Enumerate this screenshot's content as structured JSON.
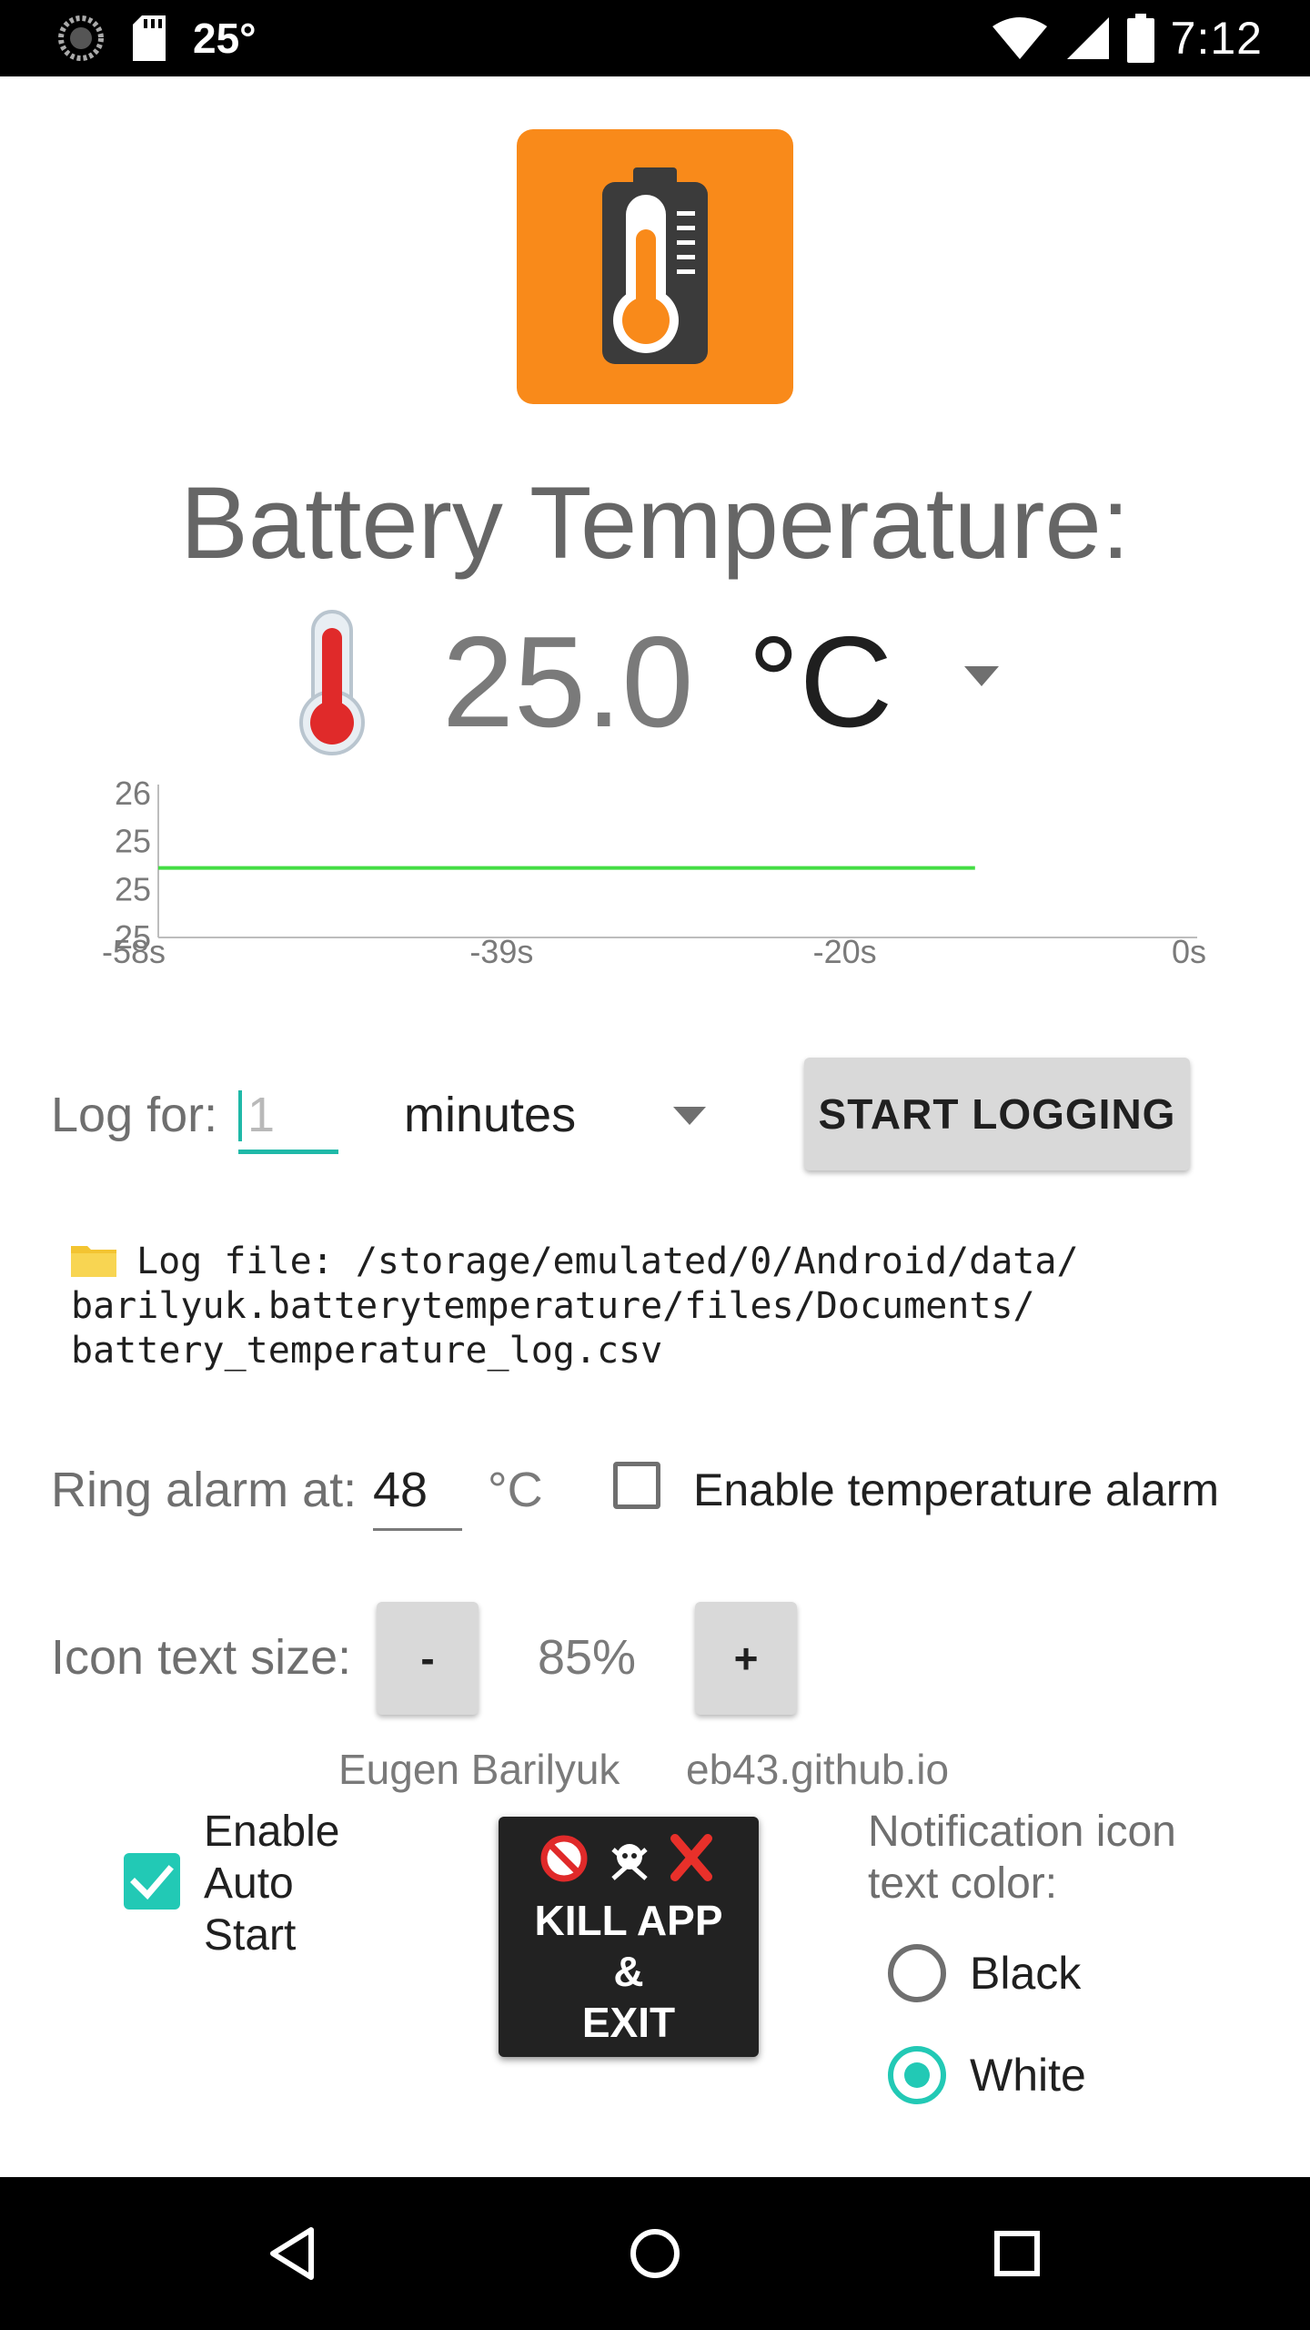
{
  "status_bar": {
    "temperature": "25°",
    "time": "7:12",
    "icons": [
      "clock-icon",
      "sd-card-icon",
      "wifi-icon",
      "cell-signal-icon",
      "battery-icon"
    ]
  },
  "app": {
    "icon": "battery-thermometer-icon",
    "icon_color": "#f98a1a",
    "title": "Battery Temperature:",
    "temperature_value": "25.0",
    "unit": "°C",
    "unit_options_icon": "dropdown-arrow-icon"
  },
  "chart_data": {
    "type": "line",
    "title": "",
    "xlabel": "",
    "ylabel": "",
    "x_tick_labels": [
      "-58s",
      "-39s",
      "-20s",
      "0s"
    ],
    "y_tick_labels": [
      "26",
      "25",
      "25",
      "25"
    ],
    "xlim": [
      -58,
      0
    ],
    "series": [
      {
        "color": "#44dd44",
        "x": [
          -58,
          -12
        ],
        "y": [
          25.0,
          25.0
        ]
      }
    ],
    "grid": false
  },
  "logging": {
    "label": "Log for:",
    "duration_value": "1",
    "units_value": "minutes",
    "start_button": "START LOGGING",
    "log_file_lines": [
      "Log file: /storage/emulated/0/Android/data/",
      "barilyuk.batterytemperature/files/Documents/",
      "battery_temperature_log.csv"
    ]
  },
  "alarm": {
    "label": "Ring alarm at:",
    "value": "48",
    "unit": "°C",
    "checkbox_label": "Enable temperature alarm",
    "enabled": false
  },
  "icon_text": {
    "label": "Icon text size:",
    "minus": "-",
    "plus": "+",
    "percent": "85%"
  },
  "credits": {
    "author": "Eugen Barilyuk",
    "site": "eb43.github.io"
  },
  "auto_start": {
    "lines": [
      "Enable",
      "Auto",
      "Start"
    ],
    "checked": true,
    "accent": "#22c9b5"
  },
  "kill_button": {
    "lines": [
      "KILL APP",
      "&",
      "EXIT"
    ],
    "icons": [
      "no-entry-icon",
      "skull-crossbones-icon",
      "cross-mark-icon"
    ]
  },
  "notification_color": {
    "label_lines": [
      "Notification icon",
      "text color:"
    ],
    "options": [
      "Black",
      "White"
    ],
    "selected": "White"
  },
  "nav_bar": {
    "icons": [
      "back-icon",
      "home-icon",
      "recents-icon"
    ]
  }
}
